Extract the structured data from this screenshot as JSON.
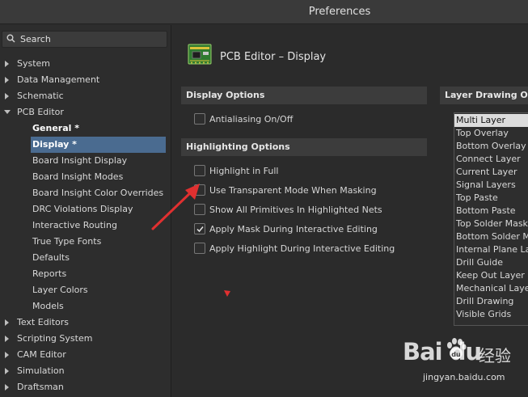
{
  "window": {
    "title": "Preferences"
  },
  "search": {
    "label": "Search"
  },
  "tree": [
    {
      "label": "System",
      "arrow": true
    },
    {
      "label": "Data Management",
      "arrow": true
    },
    {
      "label": "Schematic",
      "arrow": true
    },
    {
      "label": "PCB Editor",
      "arrow": "down"
    },
    {
      "label": "General *",
      "child": true,
      "bold": true
    },
    {
      "label": "Display *",
      "child": true,
      "bold": true,
      "selected": true
    },
    {
      "label": "Board Insight Display",
      "child": true
    },
    {
      "label": "Board Insight Modes",
      "child": true
    },
    {
      "label": "Board Insight Color Overrides",
      "child": true
    },
    {
      "label": "DRC Violations Display",
      "child": true
    },
    {
      "label": "Interactive Routing",
      "child": true
    },
    {
      "label": "True Type Fonts",
      "child": true
    },
    {
      "label": "Defaults",
      "child": true
    },
    {
      "label": "Reports",
      "child": true
    },
    {
      "label": "Layer Colors",
      "child": true
    },
    {
      "label": "Models",
      "child": true
    },
    {
      "label": "Text Editors",
      "arrow": true
    },
    {
      "label": "Scripting System",
      "arrow": true
    },
    {
      "label": "CAM Editor",
      "arrow": true
    },
    {
      "label": "Simulation",
      "arrow": true
    },
    {
      "label": "Draftsman",
      "arrow": true
    }
  ],
  "page": {
    "title": "PCB Editor – Display",
    "icon": "pcb-board-icon"
  },
  "display_options": {
    "heading": "Display Options",
    "items": [
      {
        "label": "Antialiasing On/Off",
        "checked": false
      }
    ]
  },
  "highlighting_options": {
    "heading": "Highlighting Options",
    "items": [
      {
        "label": "Highlight in Full",
        "checked": false
      },
      {
        "label": "Use Transparent Mode When Masking",
        "checked": false
      },
      {
        "label": "Show All Primitives In Highlighted Nets",
        "checked": false
      },
      {
        "label": "Apply Mask During Interactive Editing",
        "checked": true
      },
      {
        "label": "Apply Highlight During Interactive Editing",
        "checked": false
      }
    ]
  },
  "layer_drawing": {
    "heading": "Layer Drawing Orde",
    "items": [
      "Multi Layer",
      "Top Overlay",
      "Bottom Overlay",
      "Connect Layer",
      "Current Layer",
      "Signal Layers",
      "Top Paste",
      "Bottom Paste",
      "Top Solder Mask",
      "Bottom Solder Ma",
      "Internal Plane Lay",
      "Drill Guide",
      "Keep Out Layer",
      "Mechanical Layers",
      "Drill Drawing",
      "Visible Grids"
    ],
    "selected": "Multi Layer"
  },
  "watermark": {
    "logo": "Bai  du",
    "cn": "经验",
    "url": "jingyan.baidu.com"
  },
  "colors": {
    "selection": "#4a6b90",
    "annotation_red": "#e03030"
  }
}
